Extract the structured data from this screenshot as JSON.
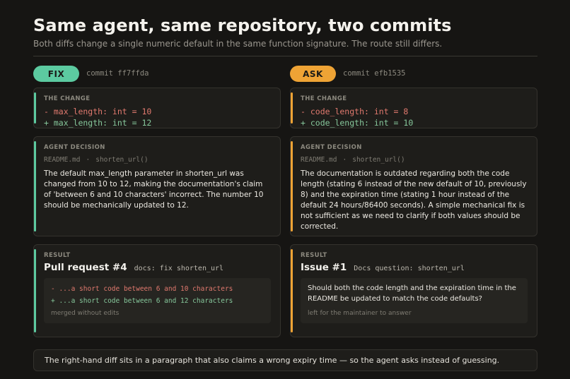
{
  "title": "Same agent, same repository, two commits",
  "subtitle": "Both diffs change a single numeric default in the same function signature. The route still differs.",
  "left": {
    "badge": "FIX",
    "commit": "commit ff7ffda",
    "change_label": "THE CHANGE",
    "diff_minus": "- max_length: int = 10",
    "diff_plus": "+ max_length: int = 12",
    "decision_label": "AGENT DECISION",
    "file": "README.md",
    "sep": "·",
    "func": "shorten_url()",
    "decision_text": "The default max_length parameter in shorten_url was changed from 10 to 12, making the documentation's claim of 'between 6 and 10 characters' incorrect. The number 10 should be mechanically updated to 12.",
    "result_label": "RESULT",
    "result_title": "Pull request #4",
    "result_sub": "docs: fix shorten_url",
    "pr_minus": "- ...a short code between 6 and 10 characters",
    "pr_plus": "+ ...a short code between 6 and 12 characters",
    "pr_note": "merged without edits"
  },
  "right": {
    "badge": "ASK",
    "commit": "commit efb1535",
    "change_label": "THE CHANGE",
    "diff_minus": "- code_length: int = 8",
    "diff_plus": "+ code_length: int = 10",
    "decision_label": "AGENT DECISION",
    "file": "README.md",
    "sep": "·",
    "func": "shorten_url()",
    "decision_text": "The documentation is outdated regarding both the code length (stating 6 instead of the new default of 10, previously 8) and the expiration time (stating 1 hour instead of the default 24 hours/86400 seconds). A simple mechanical fix is not sufficient as we need to clarify if both values should be corrected.",
    "result_label": "RESULT",
    "result_title": "Issue #1",
    "result_sub": "Docs question: shorten_url",
    "issue_text": "Should both the code length and the expiration time in the README be updated to match the code defaults?",
    "issue_note": "left for the maintainer to answer"
  },
  "footer": "The right-hand diff sits in a paragraph that also claims a wrong expiry time — so the agent asks instead of guessing.",
  "colors": {
    "fix_accent": "#5ccaa0",
    "ask_accent": "#eea335",
    "diff_removed": "#e0796e",
    "diff_added": "#86c79b",
    "background": "#161513"
  }
}
